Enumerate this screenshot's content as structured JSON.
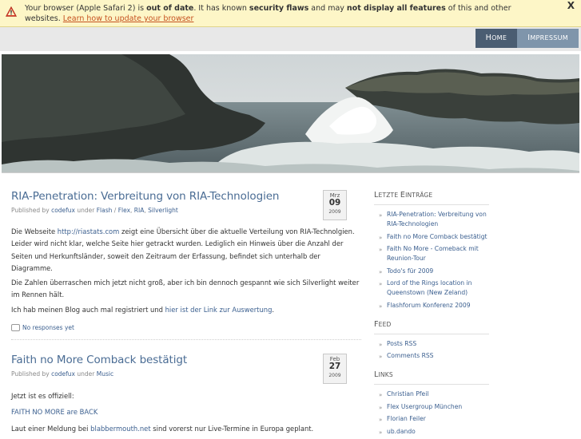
{
  "warning": {
    "prefix": "Your browser (Apple Safari 2) is ",
    "bold1": "out of date",
    "mid1": ". It has known ",
    "bold2": "security flaws",
    "mid2": " and may ",
    "bold3": "not display all features",
    "mid3": " of this and other websites. ",
    "link": "Learn how to update your browser",
    "close": "X"
  },
  "nav": {
    "home_initial": "H",
    "home_rest": "OME",
    "impressum_initial": "I",
    "impressum_rest": "MPRESSUM"
  },
  "posts": [
    {
      "title": "RIA-Penetration: Verbreitung von RIA-Technologien",
      "meta_prefix": "Published by ",
      "author": "codefux",
      "meta_under": " under ",
      "categories": [
        "Flash",
        "Flex",
        "RIA",
        "Silverlight"
      ],
      "cat_sep": " / ",
      "cat_sep2": ", ",
      "date": {
        "month": "Mrz",
        "day": "09",
        "year": "2009"
      },
      "p1_pre": "Die Webseite ",
      "p1_link": "http://riastats.com",
      "p1_post": " zeigt eine Übersicht über die aktuelle Verteilung von RIA-Technolgien. Leider wird nicht klar, welche Seite hier getrackt wurden. Lediglich ein Hinweis über die Anzahl der Seiten und Herkunftsländer, soweit den Zeitraum der Erfassung, befindet sich unterhalb der Diagramme.",
      "p2": "Die Zahlen überraschen mich jetzt nicht groß, aber ich bin dennoch gespannt wie sich Silverlight weiter im Rennen hält.",
      "p3_pre": "Ich hab meinen Blog auch mal registriert und ",
      "p3_link": "hier ist der Link zur Auswertung",
      "p3_post": ".",
      "comments": "No responses yet"
    },
    {
      "title": "Faith no More Comback bestätigt",
      "meta_prefix": "Published by ",
      "author": "codefux",
      "meta_under": " under ",
      "category": "Music",
      "date": {
        "month": "Feb",
        "day": "27",
        "year": "2009"
      },
      "p1": "Jetzt ist es offiziell:",
      "p2_link": "FAITH NO MORE are BACK",
      "p3_pre": "Laut einer Meldung bei ",
      "p3_link": "blabbermouth.net",
      "p3_post": " sind vorerst nur Live-Termine in Europa geplant."
    }
  ],
  "sidebar": {
    "recent_initial": "L",
    "recent_rest1": "ETZTE ",
    "recent_initial2": "E",
    "recent_rest2": "INTRÄGE",
    "recent": [
      "RIA-Penetration: Verbreitung von RIA-Technologien",
      "Faith no More Comback bestätigt",
      "Faith No More - Comeback mit Reunion-Tour",
      "Todo's für 2009",
      "Lord of the Rings location in Queenstown (New Zeland)",
      "Flashforum Konferenz 2009"
    ],
    "feed_initial": "F",
    "feed_rest": "EED",
    "feed": [
      "Posts RSS",
      "Comments RSS"
    ],
    "links_initial": "L",
    "links_rest": "INKS",
    "links": [
      "Christian Pfeil",
      "Flex Usergroup München",
      "Florian Feiler",
      "ub.dando"
    ]
  },
  "colors": {
    "warning_bg": "#fdf6c7",
    "nav_home": "#4a5d72",
    "nav_impressum": "#7f95ab",
    "link": "#3b5f8f",
    "title": "#4a6c94"
  }
}
